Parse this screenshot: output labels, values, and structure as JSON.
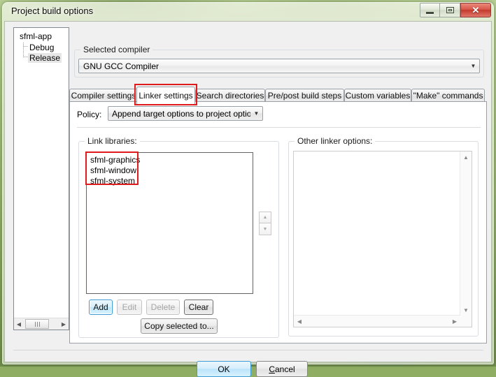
{
  "window": {
    "title": "Project build options",
    "controls": {
      "minimize": "minimize-button",
      "maximize": "maximize-button",
      "close": "✕"
    }
  },
  "tree": {
    "root": "sfml-app",
    "children": [
      {
        "label": "Debug",
        "selected": false
      },
      {
        "label": "Release",
        "selected": true
      }
    ]
  },
  "compiler_group": {
    "title": "Selected compiler",
    "selected": "GNU GCC Compiler"
  },
  "tabs": [
    {
      "label": "Compiler settings",
      "active": false
    },
    {
      "label": "Linker settings",
      "active": true
    },
    {
      "label": "Search directories",
      "active": false
    },
    {
      "label": "Pre/post build steps",
      "active": false
    },
    {
      "label": "Custom variables",
      "active": false
    },
    {
      "label": "\"Make\" commands",
      "active": false
    }
  ],
  "policy": {
    "label": "Policy:",
    "selected": "Append target options to project options"
  },
  "link_libraries": {
    "title": "Link libraries:",
    "items": [
      "sfml-graphics",
      "sfml-window",
      "sfml-system"
    ]
  },
  "other_linker_options": {
    "title": "Other linker options:",
    "value": ""
  },
  "list_buttons": [
    {
      "label": "Add",
      "state": "focused"
    },
    {
      "label": "Edit",
      "state": "disabled"
    },
    {
      "label": "Delete",
      "state": "disabled"
    },
    {
      "label": "Clear",
      "state": "enabled"
    }
  ],
  "copy_button": {
    "label": "Copy selected to..."
  },
  "footer": {
    "ok": "OK",
    "cancel_accel": "C",
    "cancel_rest": "ancel"
  },
  "highlights": {
    "tab_outline_color": "#e01b1b",
    "libs_outline_color": "#e01b1b"
  },
  "nudge": {
    "up": "▲",
    "down": "▼"
  }
}
